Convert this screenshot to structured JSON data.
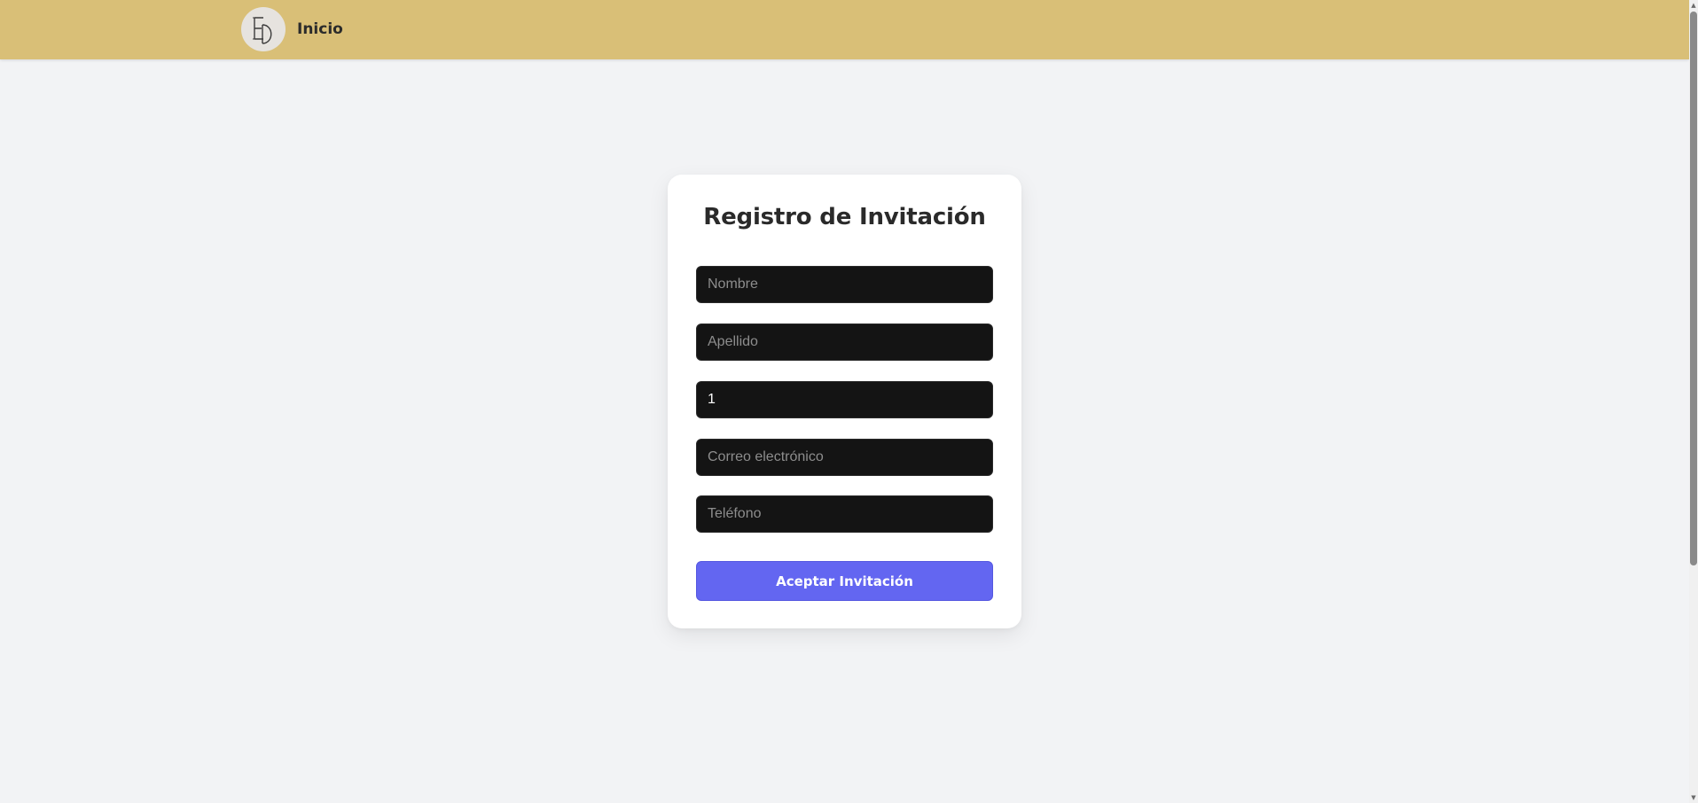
{
  "nav": {
    "logo_icon": "monogram-logo",
    "home_label": "Inicio",
    "background_color": "#d9bf77"
  },
  "form": {
    "title": "Registro de Invitación",
    "fields": [
      {
        "placeholder": "Nombre",
        "value": ""
      },
      {
        "placeholder": "Apellido",
        "value": ""
      },
      {
        "placeholder": "",
        "value": "1"
      },
      {
        "placeholder": "Correo electrónico",
        "value": ""
      },
      {
        "placeholder": "Teléfono",
        "value": ""
      }
    ],
    "submit_label": "Aceptar Invitación",
    "submit_color": "#6366f1",
    "field_color": "#141414"
  },
  "scrollbar": {
    "up_icon": "scroll-up-arrow-icon",
    "down_icon": "scroll-down-arrow-icon"
  }
}
